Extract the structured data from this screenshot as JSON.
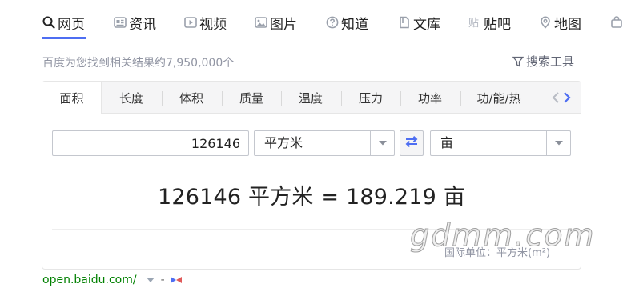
{
  "nav": {
    "items": [
      {
        "label": "网页",
        "icon": "search-icon"
      },
      {
        "label": "资讯",
        "icon": "news-icon"
      },
      {
        "label": "视频",
        "icon": "video-icon"
      },
      {
        "label": "图片",
        "icon": "image-icon"
      },
      {
        "label": "知道",
        "icon": "question-icon"
      },
      {
        "label": "文库",
        "icon": "doc-icon"
      },
      {
        "label": "贴吧",
        "icon": "tieba-icon"
      },
      {
        "label": "地图",
        "icon": "map-icon"
      }
    ],
    "active": "网页"
  },
  "results": {
    "count_text": "百度为您找到相关结果约7,950,000个",
    "tools_label": "搜索工具"
  },
  "converter": {
    "tabs": [
      "面积",
      "长度",
      "体积",
      "质量",
      "温度",
      "压力",
      "功率",
      "功/能/热"
    ],
    "active_tab": "面积",
    "input_value": "126146",
    "from_unit": "平方米",
    "to_unit": "亩",
    "result_text": "126146 平方米 = 189.219 亩",
    "intl_unit_text": "国际单位：平方米(m²)"
  },
  "watermark": "gdmm.com",
  "footer": {
    "url": "open.baidu.com/",
    "dash": "-"
  },
  "colors": {
    "accent": "#4e6ef2",
    "url_green": "#008000",
    "muted": "#9195a3"
  }
}
